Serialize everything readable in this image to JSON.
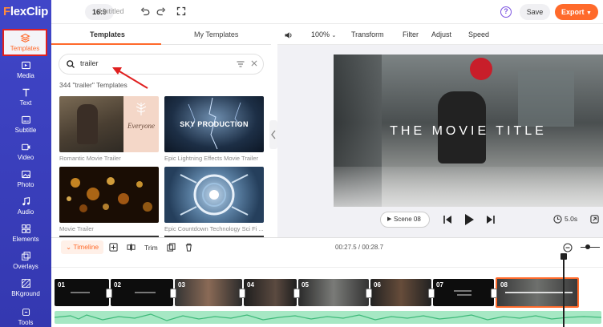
{
  "app": {
    "logo": "FlexClip"
  },
  "sidebar": {
    "items": [
      {
        "label": "Templates",
        "icon": "layers-icon"
      },
      {
        "label": "Media",
        "icon": "media-icon"
      },
      {
        "label": "Text",
        "icon": "text-icon"
      },
      {
        "label": "Subtitle",
        "icon": "subtitle-icon"
      },
      {
        "label": "Video",
        "icon": "video-icon"
      },
      {
        "label": "Photo",
        "icon": "photo-icon"
      },
      {
        "label": "Audio",
        "icon": "audio-icon"
      },
      {
        "label": "Elements",
        "icon": "elements-icon"
      },
      {
        "label": "Overlays",
        "icon": "overlays-icon"
      },
      {
        "label": "BKground",
        "icon": "background-icon"
      },
      {
        "label": "Tools",
        "icon": "tools-icon"
      }
    ]
  },
  "topbar": {
    "ratio": "16:9",
    "project_name": "Untitled",
    "save_label": "Save",
    "export_label": "Export",
    "help_label": "?"
  },
  "panel": {
    "tabs": [
      "Templates",
      "My Templates"
    ],
    "search_value": "trailer",
    "result_count": "344 \"trailer\" Templates",
    "templates": [
      {
        "caption": "Romantic Movie Trailer",
        "overlay": "Everyone"
      },
      {
        "caption": "Epic Lightning Effects Movie Trailer",
        "overlay": "SKY PRODUCTION"
      },
      {
        "caption": "Movie Trailer",
        "overlay": ""
      },
      {
        "caption": "Epic Countdown Technology Sci Fi ...",
        "overlay": ""
      }
    ]
  },
  "toolbar": {
    "zoom": "100%",
    "tools": [
      "Transform",
      "Filter",
      "Adjust",
      "Speed"
    ]
  },
  "preview": {
    "title": "THE MOVIE TITLE",
    "scene_label": "Scene 08",
    "duration": "5.0s"
  },
  "timeline": {
    "label": "Timeline",
    "trim_label": "Trim",
    "time": "00:27.5 / 00:28.7",
    "clips": [
      "01",
      "02",
      "03",
      "04",
      "05",
      "06",
      "07",
      "08"
    ]
  },
  "colors": {
    "accent": "#ff6a2b",
    "sidebar": "#3a3fbf",
    "highlight": "#e02020"
  }
}
